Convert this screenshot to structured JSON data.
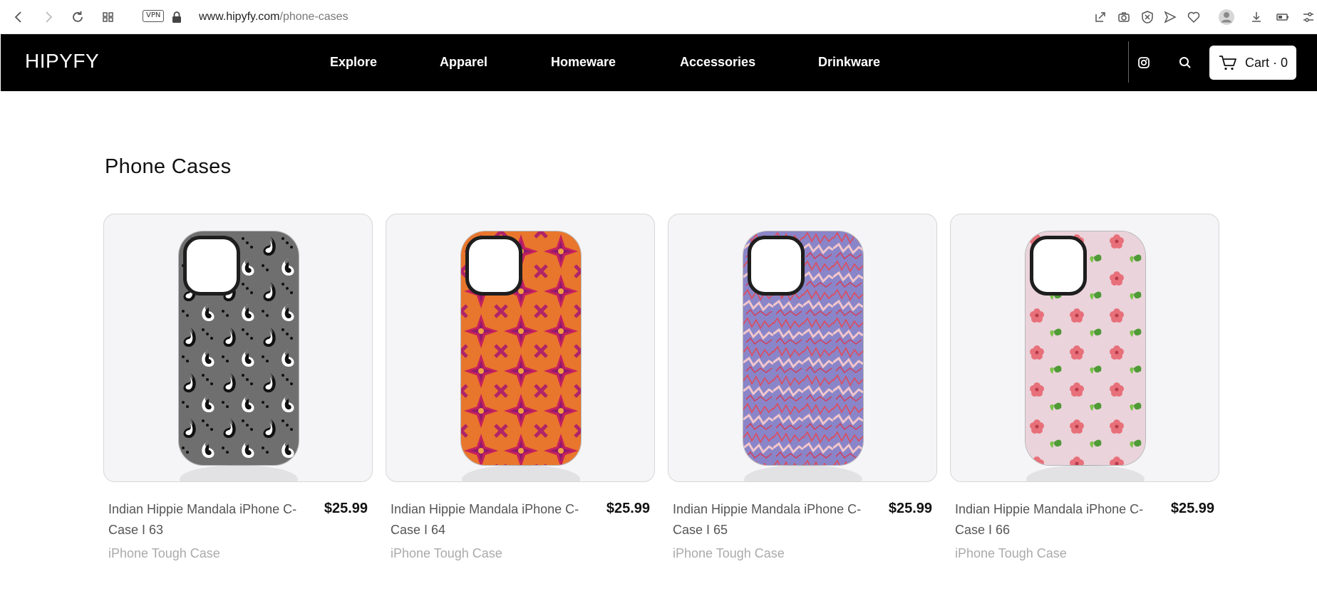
{
  "browser": {
    "vpn_label": "VPN",
    "url_domain": "www.hipyfy.com",
    "url_path": "/phone-cases"
  },
  "header": {
    "logo": "HIPYFY",
    "nav": [
      {
        "label": "Explore"
      },
      {
        "label": "Apparel"
      },
      {
        "label": "Homeware"
      },
      {
        "label": "Accessories"
      },
      {
        "label": "Drinkware"
      }
    ],
    "cart_label": "Cart · 0"
  },
  "page": {
    "title": "Phone Cases"
  },
  "products": [
    {
      "name": "Indian Hippie Mandala iPhone C-Case I 63",
      "price": "$25.99",
      "type": "iPhone Tough Case",
      "pattern": "paisley-grey"
    },
    {
      "name": "Indian Hippie Mandala iPhone C-Case I 64",
      "price": "$25.99",
      "type": "iPhone Tough Case",
      "pattern": "mandala-orange-magenta"
    },
    {
      "name": "Indian Hippie Mandala iPhone C-Case I 65",
      "price": "$25.99",
      "type": "iPhone Tough Case",
      "pattern": "zigzag-purple-red"
    },
    {
      "name": "Indian Hippie Mandala iPhone C-Case I 66",
      "price": "$25.99",
      "type": "iPhone Tough Case",
      "pattern": "floral-pink"
    }
  ],
  "colors": {
    "header_bg": "#000000",
    "card_bg": "#f5f5f7",
    "price": "#111111",
    "subtext": "#aaaaaa"
  }
}
